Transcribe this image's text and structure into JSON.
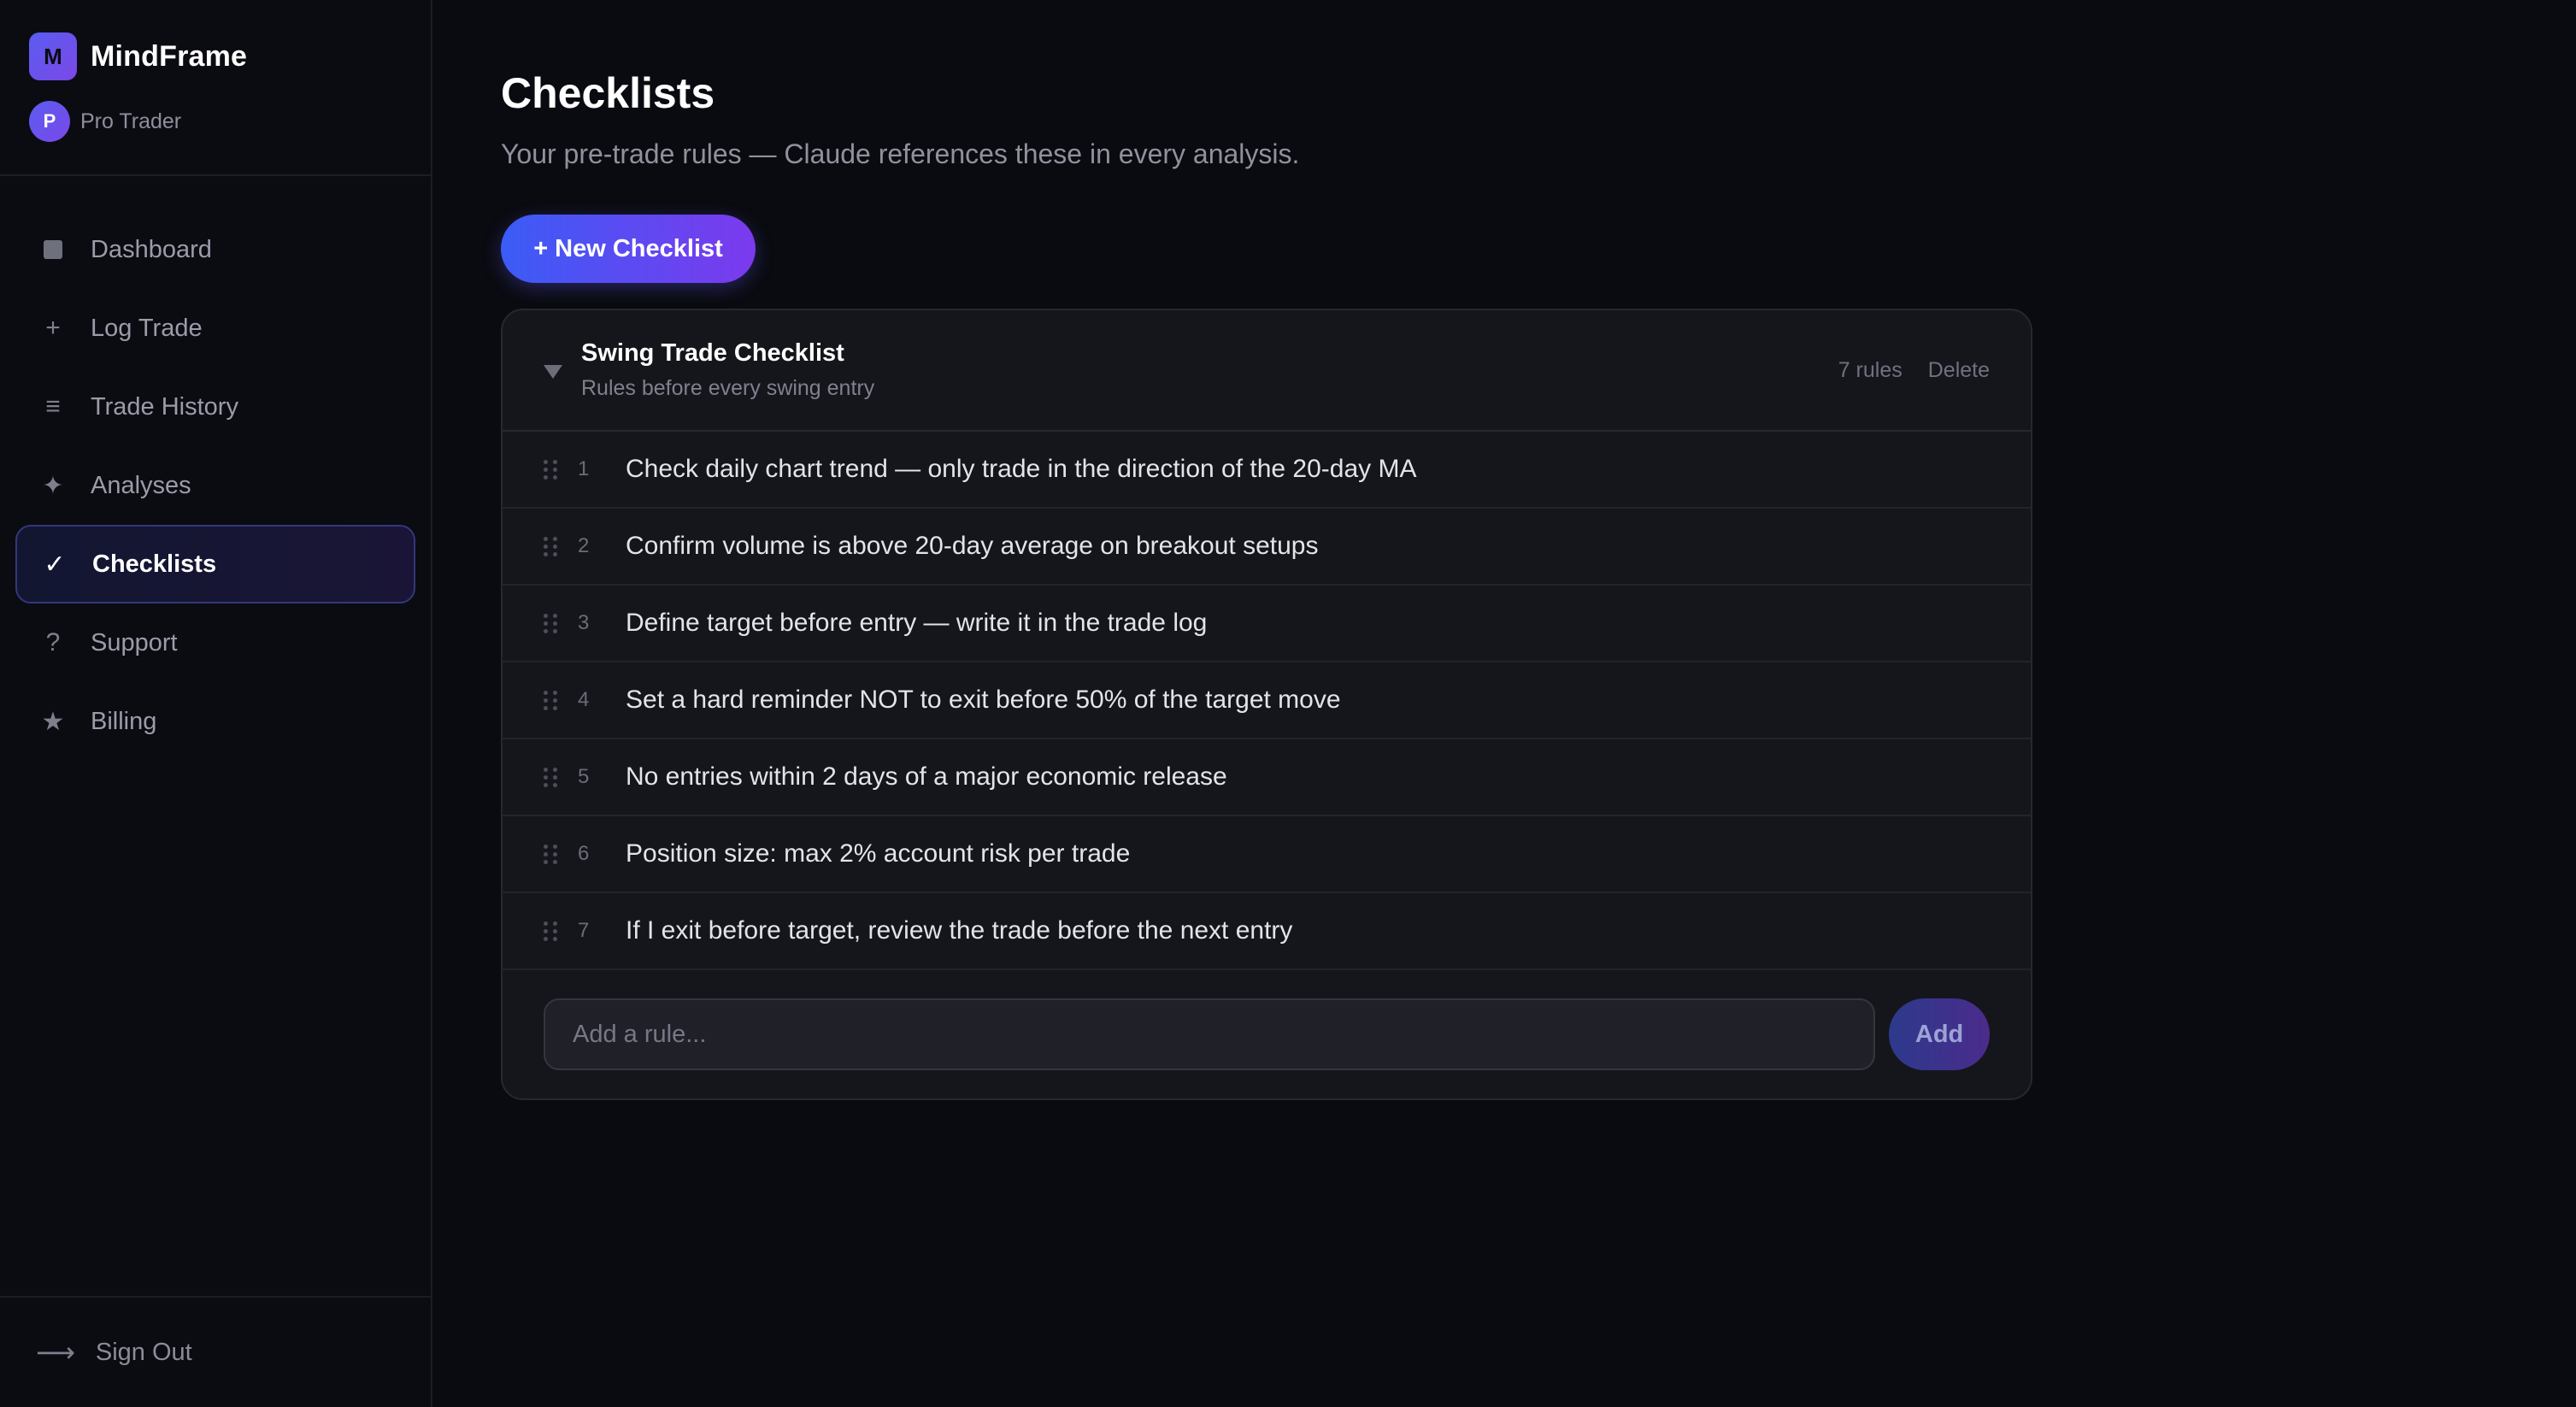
{
  "brand": {
    "logo_letter": "M",
    "name": "MindFrame"
  },
  "user": {
    "avatar_letter": "P",
    "name": "Pro Trader"
  },
  "nav": [
    {
      "label": "Dashboard",
      "icon": "square-icon"
    },
    {
      "label": "Log Trade",
      "icon": "plus-icon",
      "glyph": "+"
    },
    {
      "label": "Trade History",
      "icon": "list-icon",
      "glyph": "≡"
    },
    {
      "label": "Analyses",
      "icon": "sparkle-icon",
      "glyph": "✦"
    },
    {
      "label": "Checklists",
      "icon": "checkmark-icon",
      "glyph": "✓",
      "active": true
    },
    {
      "label": "Support",
      "icon": "question-icon",
      "glyph": "?"
    },
    {
      "label": "Billing",
      "icon": "star-icon",
      "glyph": "★"
    }
  ],
  "signout": {
    "label": "Sign Out",
    "glyph": "⟶"
  },
  "page": {
    "title": "Checklists",
    "subtitle": "Your pre-trade rules — Claude references these in every analysis.",
    "new_button": "+ New Checklist"
  },
  "checklist": {
    "title": "Swing Trade Checklist",
    "subtitle": "Rules before every swing entry",
    "count": "7 rules",
    "delete_label": "Delete",
    "rules": [
      {
        "num": "1",
        "text": "Check daily chart trend — only trade in the direction of the 20-day MA"
      },
      {
        "num": "2",
        "text": "Confirm volume is above 20-day average on breakout setups"
      },
      {
        "num": "3",
        "text": "Define target before entry — write it in the trade log"
      },
      {
        "num": "4",
        "text": "Set a hard reminder NOT to exit before 50% of the target move"
      },
      {
        "num": "5",
        "text": "No entries within 2 days of a major economic release"
      },
      {
        "num": "6",
        "text": "Position size: max 2% account risk per trade"
      },
      {
        "num": "7",
        "text": "If I exit before target, review the trade before the next entry"
      }
    ],
    "add_placeholder": "Add a rule...",
    "add_button": "Add"
  },
  "colors": {
    "accent_start": "#3b5cf6",
    "accent_end": "#7c3aed",
    "background": "#0a0b10",
    "card": "#15161c"
  }
}
